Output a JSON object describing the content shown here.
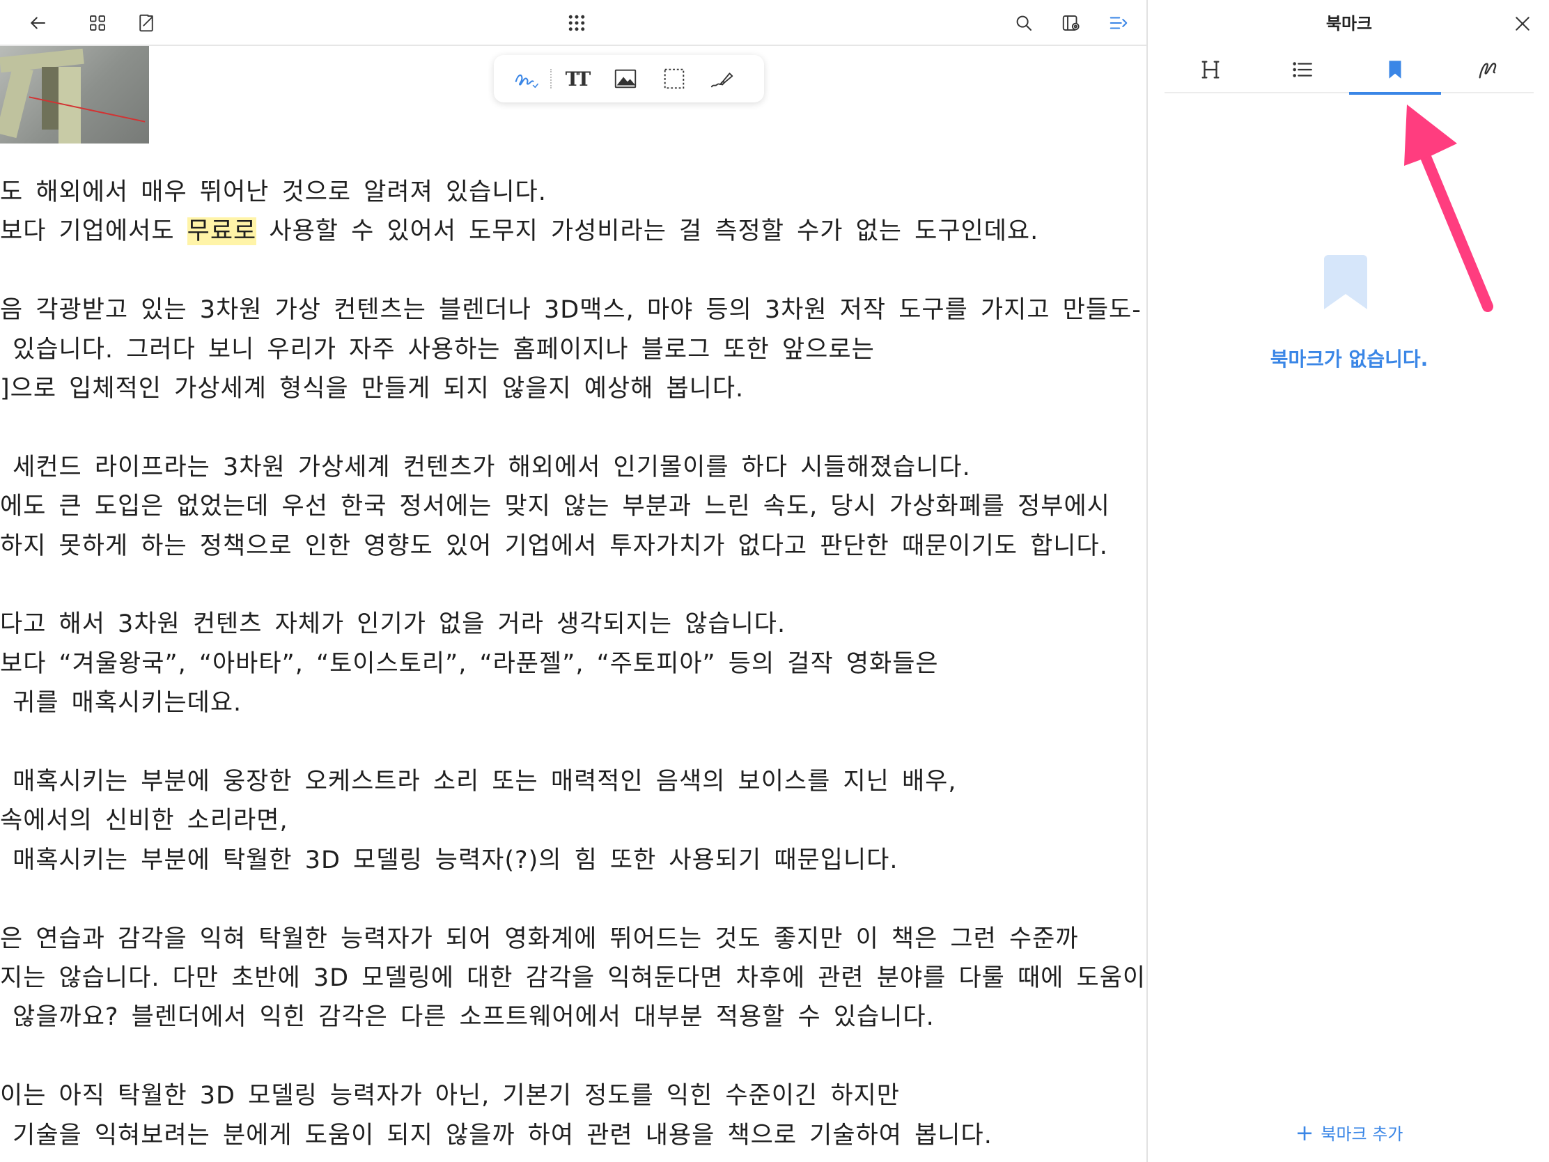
{
  "toolbar": {
    "left_icons": [
      "back-arrow-icon",
      "grid-view-icon",
      "export-icon"
    ],
    "center_icon": "apps-dots-icon",
    "right_icons": [
      "search-icon",
      "settings-icon",
      "outline-panel-icon"
    ]
  },
  "tool_palette": {
    "items": [
      "handwriting-pen-icon",
      "text-tool-icon",
      "image-tool-icon",
      "selection-tool-icon",
      "highlighter-icon"
    ],
    "text_tool_label": "TT"
  },
  "document": {
    "lines": [
      {
        "text": "도 해외에서 매우 뛰어난 것으로 알려져 있습니다."
      },
      {
        "before": "보다 기업에서도 ",
        "highlight": "무료로",
        "after": " 사용할 수 있어서 도무지 가성비라는 걸 측정할 수가 없는 도구인데요."
      },
      {
        "text": ""
      },
      {
        "text": "음 각광받고 있는 3차원 가상 컨텐츠는 블렌더나 3D맥스, 마야 등의 3차원 저작 도구를 가지고 만들도-"
      },
      {
        "text": " 있습니다. 그러다 보니 우리가 자주 사용하는 홈페이지나 블로그 또한 앞으로는"
      },
      {
        "text": "]으로 입체적인 가상세계 형식을 만들게 되지 않을지 예상해 봅니다."
      },
      {
        "text": ""
      },
      {
        "text": " 세컨드 라이프라는 3차원 가상세계 컨텐츠가 해외에서 인기몰이를 하다 시들해졌습니다."
      },
      {
        "text": "에도 큰 도입은 없었는데 우선 한국 정서에는 맞지 않는 부분과 느린 속도, 당시 가상화폐를 정부에시"
      },
      {
        "text": "하지 못하게 하는 정책으로 인한 영향도 있어 기업에서 투자가치가 없다고 판단한 때문이기도 합니다."
      },
      {
        "text": ""
      },
      {
        "text": "다고 해서 3차원 컨텐츠 자체가 인기가 없을 거라 생각되지는 않습니다."
      },
      {
        "text": "보다 “겨울왕국”, “아바타”, “토이스토리”, “라푼젤”, “주토피아” 등의 걸작 영화들은"
      },
      {
        "text": " 귀를 매혹시키는데요."
      },
      {
        "text": ""
      },
      {
        "text": " 매혹시키는 부분에 웅장한 오케스트라 소리 또는 매력적인 음색의 보이스를 지닌 배우,"
      },
      {
        "text": "속에서의 신비한 소리라면,"
      },
      {
        "text": " 매혹시키는 부분에 탁월한 3D 모델링 능력자(?)의 힘 또한 사용되기 때문입니다."
      },
      {
        "text": ""
      },
      {
        "text": "은 연습과 감각을 익혀 탁월한 능력자가 되어 영화계에 뛰어드는 것도 좋지만 이 책은 그런 수준까"
      },
      {
        "text": "지는 않습니다. 다만 초반에 3D 모델링에 대한 감각을 익혀둔다면 차후에 관련 분야를 다룰 때에 도움이"
      },
      {
        "text": " 않을까요? 블렌더에서 익힌 감각은 다른 소프트웨어에서 대부분 적용할 수 있습니다."
      },
      {
        "text": ""
      },
      {
        "text": "이는 아직 탁월한 3D 모델링 능력자가 아닌, 기본기 정도를 익힌 수준이긴 하지만"
      },
      {
        "text": " 기술을 익혀보려는 분에게 도움이 되지 않을까 하여 관련 내용을 책으로 기술하여 봅니다."
      }
    ]
  },
  "panel": {
    "title": "북마크",
    "tabs": [
      {
        "icon": "heading-icon",
        "active": false
      },
      {
        "icon": "list-icon",
        "active": false
      },
      {
        "icon": "bookmark-icon",
        "active": true
      },
      {
        "icon": "handwriting-icon",
        "active": false
      }
    ],
    "empty_message": "북마크가 없습니다.",
    "add_button_label": "북마크 추가",
    "add_button_icon": "plus-icon"
  },
  "colors": {
    "accent": "#3a86e6",
    "highlight": "#fff4a8",
    "annotation_arrow": "#ff3d7f",
    "empty_bookmark": "#d6e6fa"
  }
}
